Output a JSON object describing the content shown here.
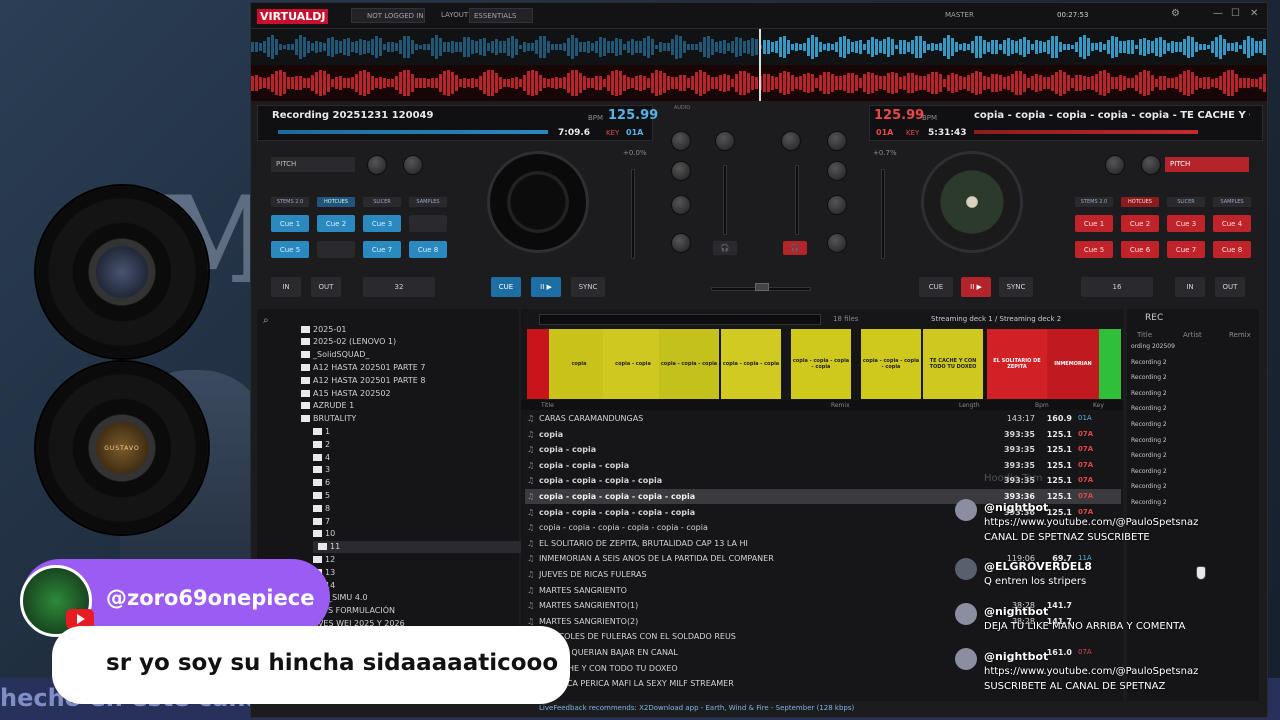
{
  "app": {
    "name": "VIRTUALDJ",
    "login": "NOT LOGGED IN",
    "layout_label": "LAYOUT",
    "layout_value": "ESSENTIALS",
    "master_label": "MASTER",
    "clock": "00:27:53"
  },
  "deck_left": {
    "title": "Recording 20251231 120049",
    "bpm": "125.99",
    "bpm_label": "BPM",
    "time": "7:09.6",
    "key_label": "KEY",
    "key": "01A",
    "pitch_label": "PITCH",
    "pitch": "+0.0%",
    "tabs": [
      "STEMS 2.0",
      "HOTCUES",
      "SLICER",
      "SAMPLES"
    ],
    "pads": [
      "Cue 1",
      "Cue 2",
      "Cue 3",
      "",
      "Cue 5",
      "",
      "Cue 7",
      "Cue 8"
    ],
    "buttons": {
      "in": "IN",
      "out": "OUT",
      "loop": "32",
      "cue": "CUE",
      "play": "II ▶",
      "sync": "SYNC"
    }
  },
  "deck_right": {
    "title": "copia - copia - copia - copia - copia  -  TE CACHE Y CON",
    "bpm": "125.99",
    "bpm_label": "BPM",
    "time": "5:31:43",
    "key_label": "KEY",
    "key": "01A",
    "pitch_label": "PITCH",
    "pitch": "+0.7%",
    "tabs": [
      "STEMS 2.0",
      "HOTCUES",
      "SLICER",
      "SAMPLES"
    ],
    "pads": [
      "Cue 1",
      "Cue 2",
      "Cue 3",
      "Cue 4",
      "Cue 5",
      "Cue 6",
      "Cue 7",
      "Cue 8"
    ],
    "buttons": {
      "in": "IN",
      "out": "OUT",
      "loop": "16",
      "cue": "CUE",
      "play": "II ▶",
      "sync": "SYNC"
    }
  },
  "mixer": {
    "labels": [
      "AUDIO",
      "VIDEO",
      "SCRATCH",
      "MASTER",
      "HIGH",
      "MID",
      "LOW",
      "FILTER",
      "GAIN",
      "GAIN",
      "FX",
      "PAD",
      "LOOP"
    ]
  },
  "browser": {
    "folders": [
      "2025-01",
      "2025-02 (LENOVO 1)",
      "_SolidSQUAD_",
      "A12 HASTA 202501 PARTE 7",
      "A12 HASTA 202501 PARTE 8",
      "A15 HASTA 202502",
      "AZRUDE 1",
      "BRUTALITY",
      "1",
      "2",
      "4",
      "3",
      "6",
      "5",
      "8",
      "7",
      "10",
      "11",
      "12",
      "13",
      "14",
      "_De_SIMU 4.0",
      "RATS FORMULACIÓN",
      "AVES WEI 2025 Y 2026"
    ],
    "files_count": "18 files",
    "streaming": "Streaming deck 1 / Streaming deck 2",
    "columns": {
      "title": "Title",
      "remix": "Remix",
      "length": "Length",
      "bpm": "Bpm",
      "key": "Key"
    },
    "covers": [
      "CARA",
      "copia",
      "copia - copia",
      "copia - copia - copia",
      "copia - copia - copia",
      "copia - copia - copia - copia",
      "copia - copia - copia - copia",
      "TE CACHE Y CON TODO TU DOXEO",
      "EL SOLITARIO DE ZEPITA",
      "INMEMORIAN"
    ],
    "tracks": [
      {
        "title": "CARAS CARAMANDUNGAS",
        "length": "143:17",
        "bpm": "160.9",
        "key": "01A"
      },
      {
        "title": "copia",
        "length": "393:35",
        "bpm": "125.1",
        "key": "07A"
      },
      {
        "title": "copia - copia",
        "length": "393:35",
        "bpm": "125.1",
        "key": "07A"
      },
      {
        "title": "copia - copia - copia",
        "length": "393:35",
        "bpm": "125.1",
        "key": "07A"
      },
      {
        "title": "copia - copia - copia - copia",
        "length": "393:35",
        "bpm": "125.1",
        "key": "07A"
      },
      {
        "title": "copia - copia - copia - copia - copia",
        "length": "393:36",
        "bpm": "125.1",
        "key": "07A"
      },
      {
        "title": "copia - copia - copia - copia - copia",
        "length": "393:36",
        "bpm": "125.1",
        "key": "07A"
      },
      {
        "title": "copia - copia - copia - copia - copia - copia",
        "length": "",
        "bpm": "",
        "key": ""
      },
      {
        "title": "EL SOLITARIO DE ZEPITA, BRUTALIDAD CAP 13 LA HI",
        "length": "",
        "bpm": "",
        "key": ""
      },
      {
        "title": "INMEMORIAN A SEIS ANOS DE LA PARTIDA DEL COMPANER",
        "length": "119:06",
        "bpm": "69.7",
        "key": "11A"
      },
      {
        "title": "JUEVES DE RICAS FULERAS",
        "length": "",
        "bpm": "",
        "key": ""
      },
      {
        "title": "MARTES SANGRIENTO",
        "length": "",
        "bpm": "",
        "key": ""
      },
      {
        "title": "MARTES SANGRIENTO(1)",
        "length": "38:28",
        "bpm": "141.7",
        "key": ""
      },
      {
        "title": "MARTES SANGRIENTO(2)",
        "length": "38:28",
        "bpm": "141.7",
        "key": ""
      },
      {
        "title": "MIERCOLES DE FULERAS CON EL SOLDADO REUS",
        "length": "",
        "bpm": "",
        "key": ""
      },
      {
        "title": "QUE SE QUERIAN BAJAR EN CANAL",
        "length": "",
        "bpm": "161.0",
        "key": "07A"
      },
      {
        "title": "TE CACHE Y CON TODO TU DOXEO",
        "length": "",
        "bpm": "",
        "key": ""
      },
      {
        "title": "UNA RICA PERICA MAFI LA SEXY MILF STREAMER",
        "length": "",
        "bpm": "",
        "key": ""
      }
    ],
    "livefeedback": "LiveFeedback recommends: X2Download app - Earth, Wind & Fire - September (128 kbps)",
    "rec_header": "REC",
    "rec_cols": [
      "Title",
      "Artist",
      "Remix"
    ],
    "rec_items": [
      "ording 202509",
      "Recording 2",
      "Recording 2",
      "Recording 2",
      "Recording 2",
      "Recording 2",
      "Recording 2",
      "Recording 2",
      "Recording 2",
      "Recording 2",
      "Recording 2"
    ]
  },
  "chat": [
    {
      "name": "@nightbot",
      "lines": [
        "https://www.youtube.com/@PauloSpetsnaz",
        "CANAL DE SPETNAZ SUSCRIBETE"
      ]
    },
    {
      "name": "@ELGROVERDEL8",
      "lines": [
        "Q entren los stripers"
      ]
    },
    {
      "name": "@nightbot",
      "lines": [
        "DEJA TU LIKE MANO ARRIBA Y COMENTA"
      ]
    },
    {
      "name": "@nightbot",
      "lines": [
        "https://www.youtube.com/@PauloSpetsnaz",
        "SUSCRIBETE AL CANAL DE SPETNAZ"
      ]
    }
  ],
  "chat_ghost": "Hoodie Tom",
  "overlay": {
    "username": "@zoro69onepiece",
    "message": "sr yo soy su hincha sidaaaaaticooo"
  },
  "background": {
    "letter": "M",
    "strip_text": "hecho en este cana",
    "vinyl2_label": "GUSTAVO"
  },
  "colors": {
    "accent_blue": "#52b4e8",
    "accent_red": "#e84848",
    "purple": "#9a5cf2"
  }
}
